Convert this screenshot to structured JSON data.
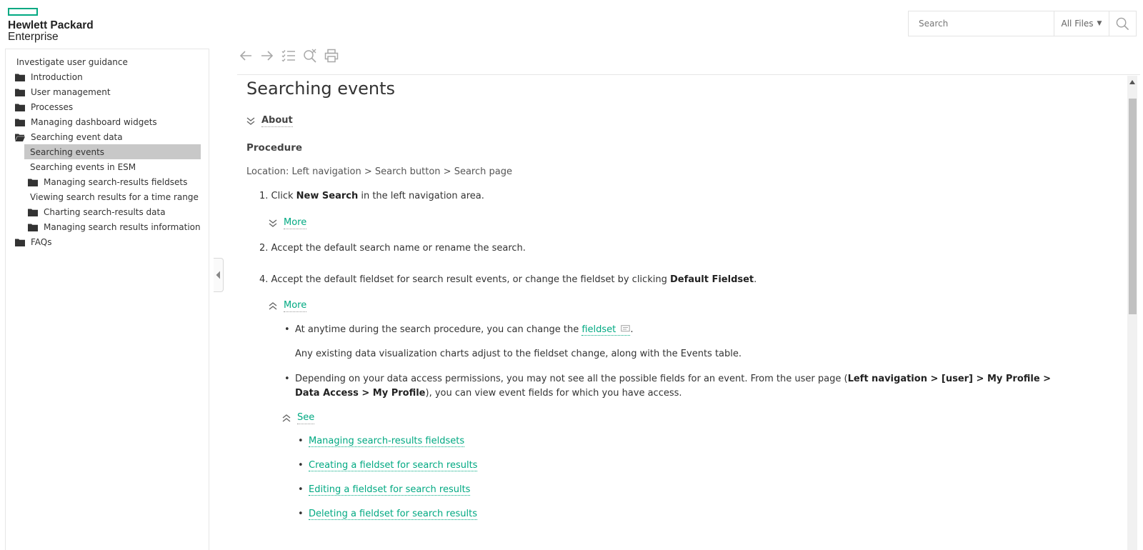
{
  "brand": {
    "line1": "Hewlett Packard",
    "line2": "Enterprise",
    "accent": "#01a982"
  },
  "search": {
    "placeholder": "Search",
    "scope": "All Files",
    "icon": "search-icon"
  },
  "sidebar": {
    "items": [
      {
        "label": "Investigate user guidance",
        "icon": "none"
      },
      {
        "label": "Introduction",
        "icon": "folder-icon"
      },
      {
        "label": "User management",
        "icon": "folder-icon"
      },
      {
        "label": "Processes",
        "icon": "folder-icon"
      },
      {
        "label": "Managing dashboard widgets",
        "icon": "folder-icon"
      },
      {
        "label": "Searching event data",
        "icon": "folder-open-icon"
      },
      {
        "label": "Searching events",
        "icon": "none",
        "selected": true
      },
      {
        "label": "Searching events in ESM",
        "icon": "none"
      },
      {
        "label": "Managing search-results fieldsets",
        "icon": "folder-icon"
      },
      {
        "label": "Viewing search results for a time range",
        "icon": "none"
      },
      {
        "label": "Charting search-results data",
        "icon": "folder-icon"
      },
      {
        "label": "Managing search results information",
        "icon": "folder-icon"
      },
      {
        "label": "FAQs",
        "icon": "folder-icon"
      }
    ]
  },
  "toolbar": {
    "buttons": [
      "back-arrow-icon",
      "forward-arrow-icon",
      "toc-list-icon",
      "clear-highlight-icon",
      "print-icon"
    ]
  },
  "content": {
    "title": "Searching events",
    "about_label": "About",
    "procedure_heading": "Procedure",
    "location": "Location: Left navigation > Search button > Search page",
    "step1": {
      "num": "1.",
      "pre": "Click ",
      "bold": "New Search",
      "post": " in the left navigation area."
    },
    "more_label_1": "More",
    "step2": {
      "num": "2.",
      "text": "Accept the default search name or rename the search."
    },
    "step4": {
      "num": "4.",
      "pre": "Accept the default fieldset for search result events, or change the fieldset by clicking ",
      "bold": "Default Fieldset",
      "post": "."
    },
    "more_label_2": "More",
    "bullet1": {
      "pre": "At anytime during the search procedure, you can change the ",
      "link": "fieldset",
      "post": "."
    },
    "bullet1_note": "Any existing data visualization charts adjust to the fieldset change, along with the Events table.",
    "bullet2": {
      "pre": "Depending on your data access permissions, you may not see all the possible fields for an event. From the user page (",
      "bold": "Left navigation > [user] > My Profile > Data Access > My Profile",
      "post": "), you can view event fields for which you have access."
    },
    "see_label": "See",
    "see_links": [
      "Managing search-results fieldsets",
      "Creating a fieldset for search results",
      "Editing a fieldset for search results",
      "Deleting a fieldset for search results"
    ]
  }
}
